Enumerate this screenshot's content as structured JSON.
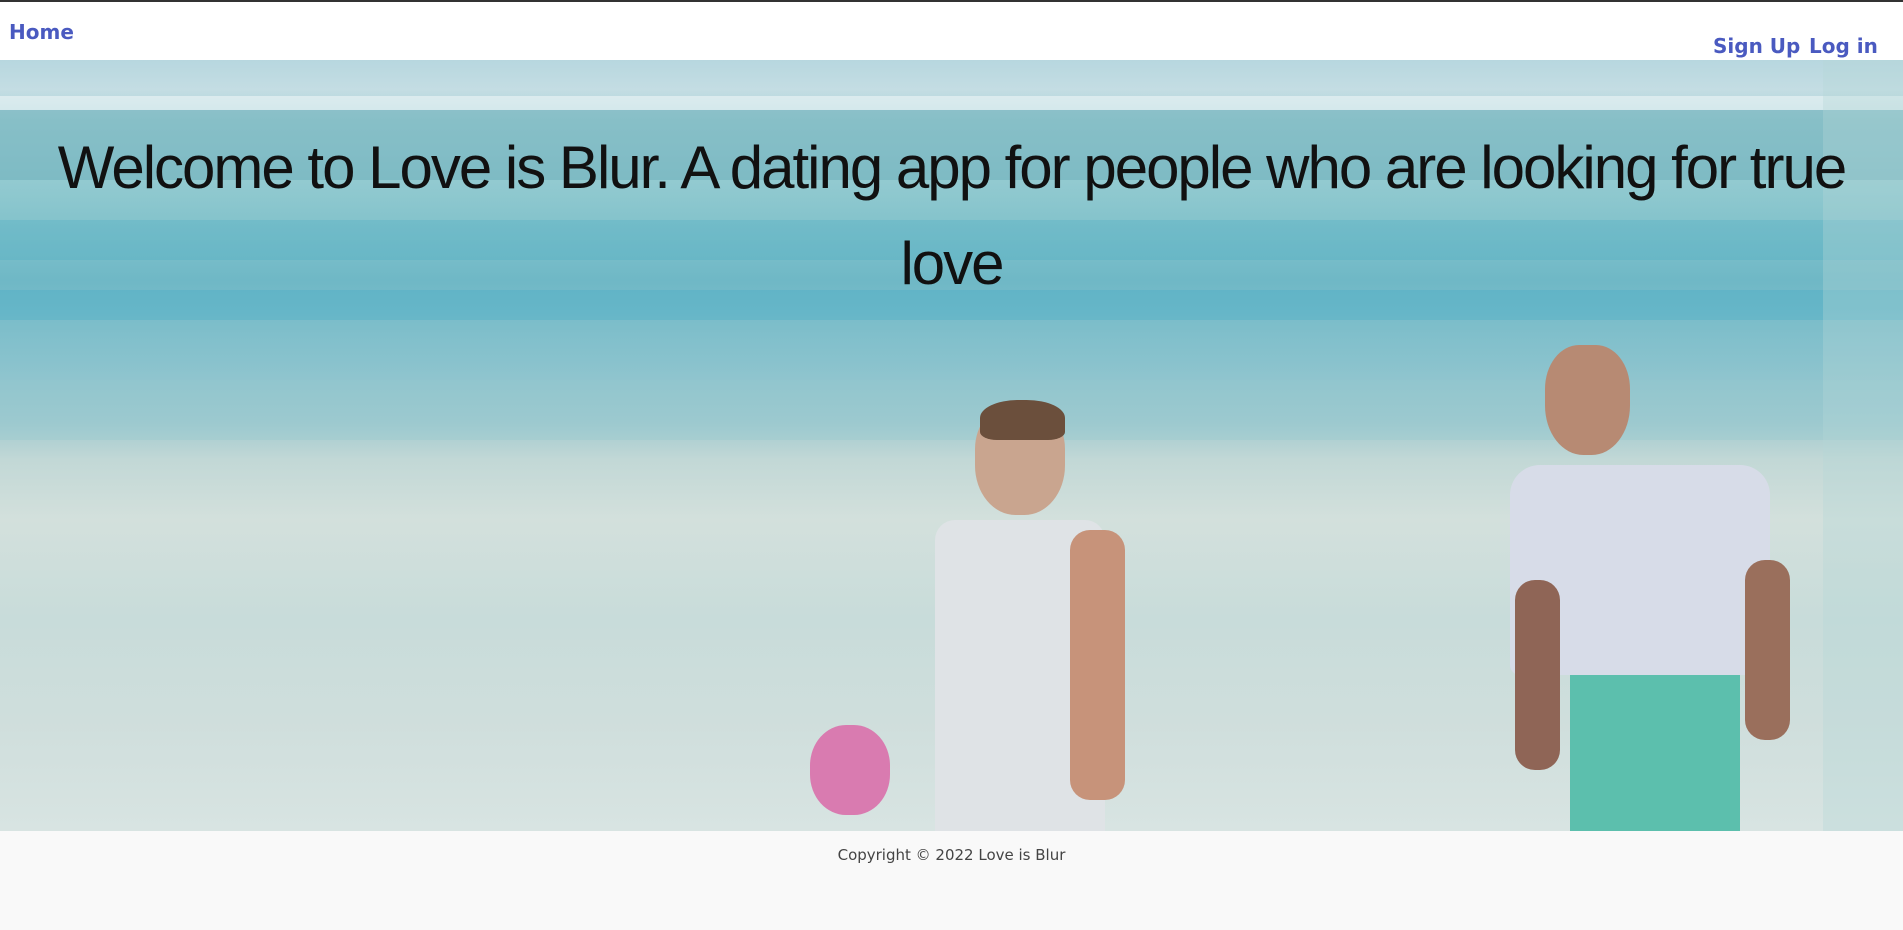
{
  "navbar": {
    "home_label": "Home",
    "signup_label": "Sign Up",
    "login_label": "Log in"
  },
  "hero": {
    "title": "Welcome to Love is Blur. A dating app for people who are looking for true love"
  },
  "footer": {
    "copyright": "Copyright © 2022 Love is Blur"
  },
  "colors": {
    "nav_link": "#4a5ac0",
    "title_text": "#111111"
  }
}
